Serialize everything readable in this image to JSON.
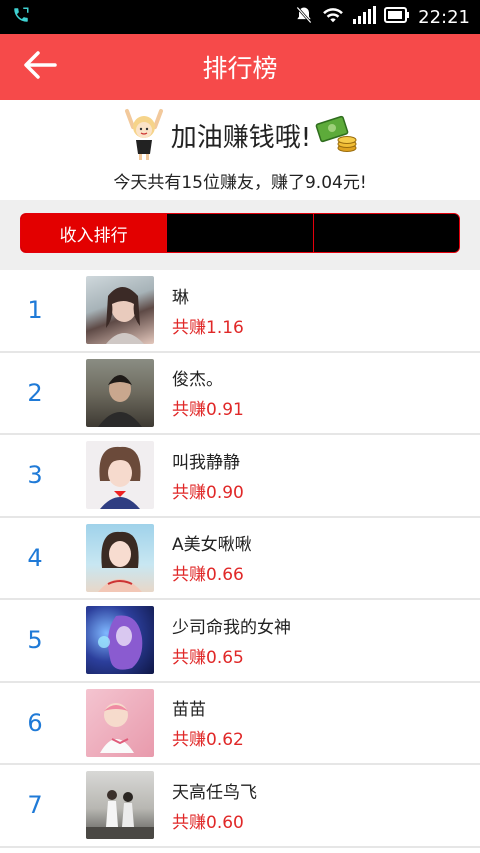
{
  "status_bar": {
    "time": "22:21",
    "icons": [
      "phone-icon",
      "mute-icon",
      "wifi-icon",
      "signal-icon",
      "battery-icon"
    ]
  },
  "header": {
    "title": "排行榜",
    "back_icon": "arrow-left-icon"
  },
  "banner": {
    "title": "加油赚钱哦!",
    "subtitle": "今天共有15位赚友，赚了9.04元!"
  },
  "tabs": [
    {
      "label": "收入排行",
      "active": true
    },
    {
      "label": "",
      "active": false
    },
    {
      "label": "",
      "active": false
    }
  ],
  "ranking": [
    {
      "rank": "1",
      "name": "琳",
      "earned": "共赚1.16"
    },
    {
      "rank": "2",
      "name": "俊杰。",
      "earned": "共赚0.91"
    },
    {
      "rank": "3",
      "name": "叫我静静",
      "earned": "共赚0.90"
    },
    {
      "rank": "4",
      "name": "A美女啾啾",
      "earned": "共赚0.66"
    },
    {
      "rank": "5",
      "name": "少司命我的女神",
      "earned": "共赚0.65"
    },
    {
      "rank": "6",
      "name": "苗苗",
      "earned": "共赚0.62"
    },
    {
      "rank": "7",
      "name": "天高任鸟飞",
      "earned": "共赚0.60"
    }
  ],
  "colors": {
    "accent": "#f64a4a",
    "tab_active": "#e30000",
    "rank": "#1f7ad7",
    "earn": "#e02828"
  }
}
